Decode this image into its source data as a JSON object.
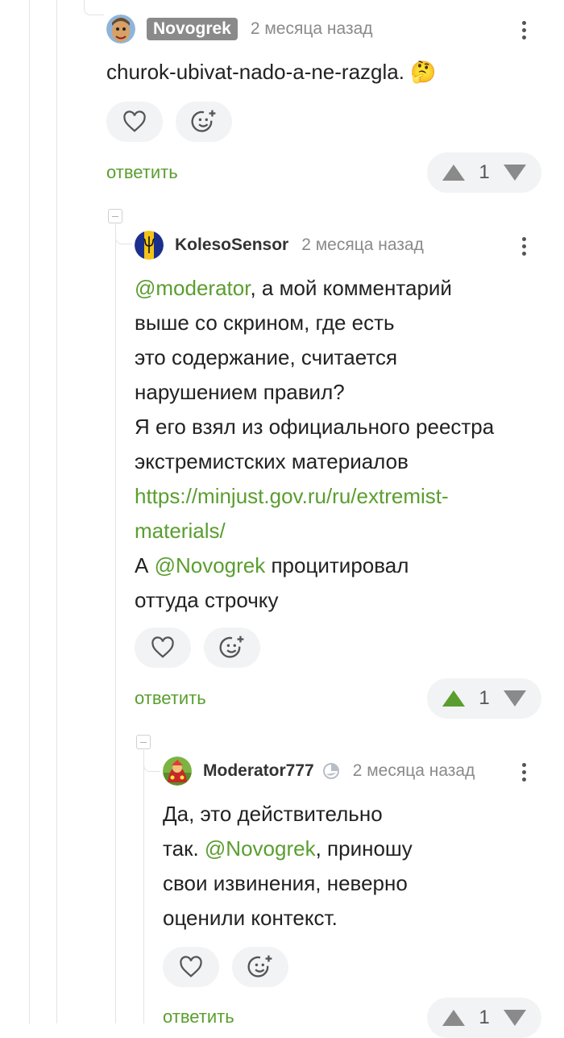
{
  "comments": [
    {
      "username": "Novogrek",
      "time": "2 месяца назад",
      "text": "churok-ubivat-nado-a-ne-razgla. 🤔",
      "reply_label": "ответить",
      "rating": "1",
      "upvote_active": false
    },
    {
      "username": "KolesoSensor",
      "time": "2 месяца назад",
      "text_lines": [
        {
          "mention": "@moderator",
          "rest": ", а мой комментарий"
        },
        {
          "plain": "выше со скрином, где есть"
        },
        {
          "plain": "это содержание, считается"
        },
        {
          "plain": "нарушением правил?"
        },
        {
          "plain": "Я его взял из официального реестра"
        },
        {
          "plain": "экстремистских материалов"
        },
        {
          "link": "https://minjust.gov.ru/ru/extremist-"
        },
        {
          "link": "materials/"
        },
        {
          "prefix": "А ",
          "mention": "@Novogrek",
          "rest": " процитировал"
        },
        {
          "plain": "оттуда строчку"
        }
      ],
      "reply_label": "ответить",
      "rating": "1",
      "upvote_active": true
    },
    {
      "username": "Moderator777",
      "time": "2 месяца назад",
      "text_lines": [
        {
          "plain": "Да, это действительно"
        },
        {
          "prefix": "так. ",
          "mention": "@Novogrek",
          "rest": ", приношу"
        },
        {
          "plain": "свои извинения, неверно"
        },
        {
          "plain": "оценили контекст."
        }
      ],
      "reply_label": "ответить",
      "rating": "1",
      "upvote_active": false
    }
  ],
  "colors": {
    "accent": "#5a9e2f",
    "muted": "#8a8a8a",
    "pill_bg": "#f2f3f4"
  },
  "icons": [
    "heart-icon",
    "emoji-add-icon",
    "upvote-icon",
    "downvote-icon",
    "kebab-menu-icon",
    "collapse-icon",
    "moderator-badge-icon"
  ]
}
